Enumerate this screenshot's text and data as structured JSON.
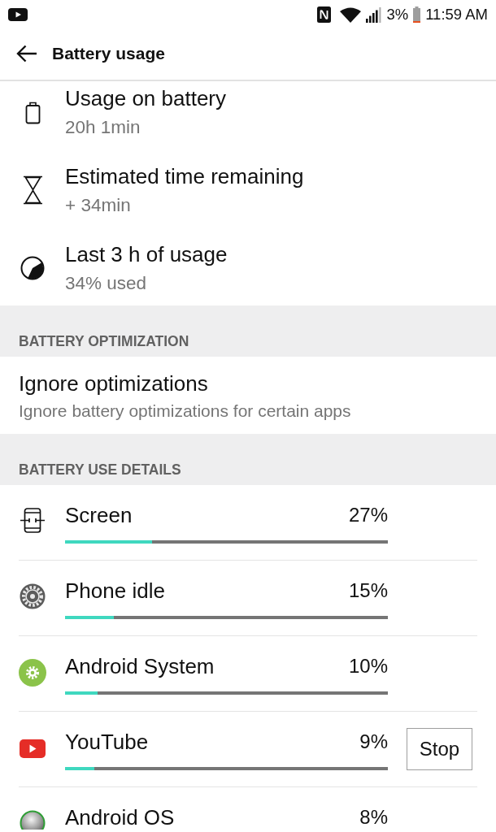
{
  "status_bar": {
    "battery_percent": "3%",
    "time": "11:59 AM"
  },
  "app_bar": {
    "title": "Battery usage"
  },
  "summary": [
    {
      "kind": "battery",
      "title": "Usage on battery",
      "subtitle": "20h 1min"
    },
    {
      "kind": "hourglass",
      "title": "Estimated time remaining",
      "subtitle": "+ 34min"
    },
    {
      "kind": "pie",
      "title": "Last 3 h of usage",
      "subtitle": "34% used"
    }
  ],
  "optimization": {
    "header": "BATTERY OPTIMIZATION",
    "item": {
      "title": "Ignore optimizations",
      "subtitle": "Ignore battery optimizations for certain apps"
    }
  },
  "details": {
    "header": "BATTERY USE DETAILS",
    "apps": [
      {
        "kind": "screen",
        "name": "Screen",
        "percent": "27%",
        "level": 0.27
      },
      {
        "kind": "idle",
        "name": "Phone idle",
        "percent": "15%",
        "level": 0.15
      },
      {
        "kind": "system",
        "name": "Android System",
        "percent": "10%",
        "level": 0.1
      },
      {
        "kind": "youtube",
        "name": "YouTube",
        "percent": "9%",
        "level": 0.09,
        "button": "Stop"
      },
      {
        "kind": "os",
        "name": "Android OS",
        "percent": "8%"
      }
    ]
  }
}
